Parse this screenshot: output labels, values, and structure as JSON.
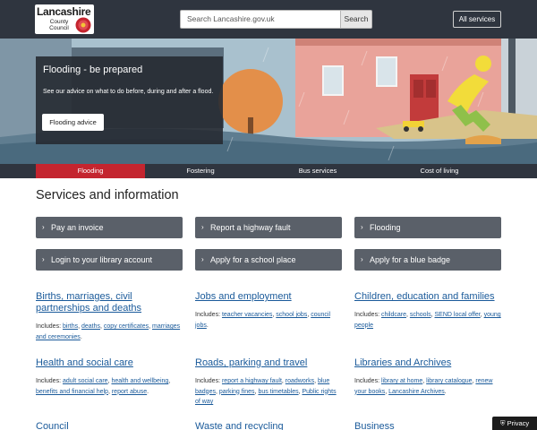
{
  "header": {
    "logo_line1": "Lancashire",
    "logo_line2": "County\nCouncil",
    "search_placeholder": "Search Lancashire.gov.uk",
    "search_button": "Search",
    "all_services": "All services"
  },
  "hero": {
    "title": "Flooding - be prepared",
    "text": "See our advice on what to do before, during and after a flood.",
    "button": "Flooding advice"
  },
  "tabs": [
    {
      "label": "Flooding",
      "active": true
    },
    {
      "label": "Fostering",
      "active": false
    },
    {
      "label": "Bus services",
      "active": false
    },
    {
      "label": "Cost of living",
      "active": false
    }
  ],
  "services": {
    "title": "Services and information",
    "buttons": [
      "Pay an invoice",
      "Report a highway fault",
      "Flooding",
      "Login to your library account",
      "Apply for a school place",
      "Apply for a blue badge"
    ]
  },
  "topics": {
    "includes_label": "Includes: ",
    "births": {
      "title": "Births, marriages, civil partnerships and deaths",
      "links": [
        "births",
        "deaths",
        "copy certificates",
        "marriages and ceremonies"
      ]
    },
    "jobs": {
      "title": "Jobs and employment",
      "links": [
        "teacher vacancies",
        "school jobs",
        "council jobs"
      ]
    },
    "children": {
      "title": "Children, education and families",
      "links": [
        "childcare",
        "schools",
        "SEND local offer",
        "young people"
      ]
    },
    "health": {
      "title": "Health and social care",
      "links": [
        "adult social care",
        "health and wellbeing",
        "benefits and financial help",
        "report abuse"
      ]
    },
    "roads": {
      "title": "Roads, parking and travel",
      "links": [
        "report a highway fault",
        "roadworks",
        "blue badges",
        "parking fines",
        "bus timetables",
        "Public rights of way"
      ]
    },
    "libraries": {
      "title": "Libraries and Archives",
      "links": [
        "library at home",
        "library catalogue",
        "renew your books",
        "Lancashire Archives"
      ]
    },
    "council": {
      "title": "Council"
    },
    "waste": {
      "title": "Waste and recycling"
    },
    "business": {
      "title": "Business"
    }
  },
  "privacy": "Privacy",
  "colors": {
    "header": "#2f353f",
    "accent_red": "#c4252f",
    "button_grey": "#5a6069",
    "link_blue": "#1a5a9a"
  }
}
